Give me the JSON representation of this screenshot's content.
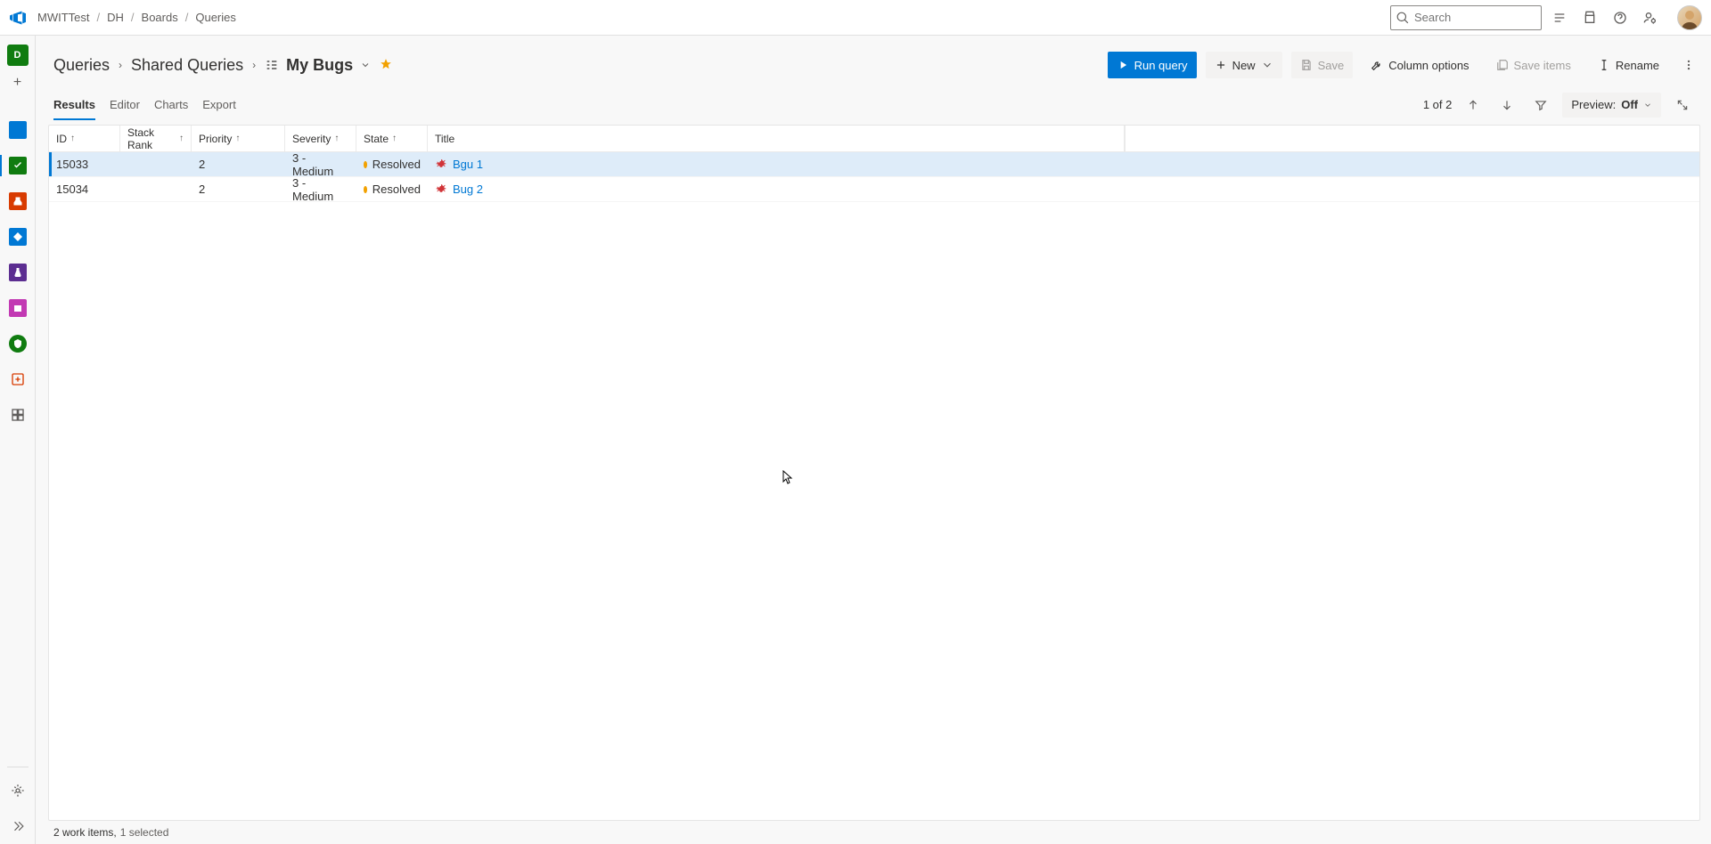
{
  "breadcrumbs": [
    "MWITTest",
    "DH",
    "Boards",
    "Queries"
  ],
  "search": {
    "placeholder": "Search"
  },
  "sidebar": {
    "project_initial": "D",
    "project_color": "#107c10"
  },
  "page": {
    "crumb1": "Queries",
    "crumb2": "Shared Queries",
    "current": "My Bugs"
  },
  "actions": {
    "run_query": "Run query",
    "new": "New",
    "save": "Save",
    "column_options": "Column options",
    "save_items": "Save items",
    "rename": "Rename"
  },
  "tabs": [
    "Results",
    "Editor",
    "Charts",
    "Export"
  ],
  "tabs_right": {
    "position": "1 of 2",
    "preview_label": "Preview:",
    "preview_value": "Off"
  },
  "columns": {
    "id": "ID",
    "stack_rank": "Stack Rank",
    "priority": "Priority",
    "severity": "Severity",
    "state": "State",
    "title": "Title"
  },
  "rows": [
    {
      "id": "15033",
      "stack_rank": "",
      "priority": "2",
      "severity": "3 - Medium",
      "state_color": "#f2a100",
      "state": "Resolved",
      "title": "Bgu 1",
      "selected": true
    },
    {
      "id": "15034",
      "stack_rank": "",
      "priority": "2",
      "severity": "3 - Medium",
      "state_color": "#f2a100",
      "state": "Resolved",
      "title": "Bug 2",
      "selected": false
    }
  ],
  "footer": {
    "work_items": "2 work items,",
    "selected": "1 selected"
  }
}
